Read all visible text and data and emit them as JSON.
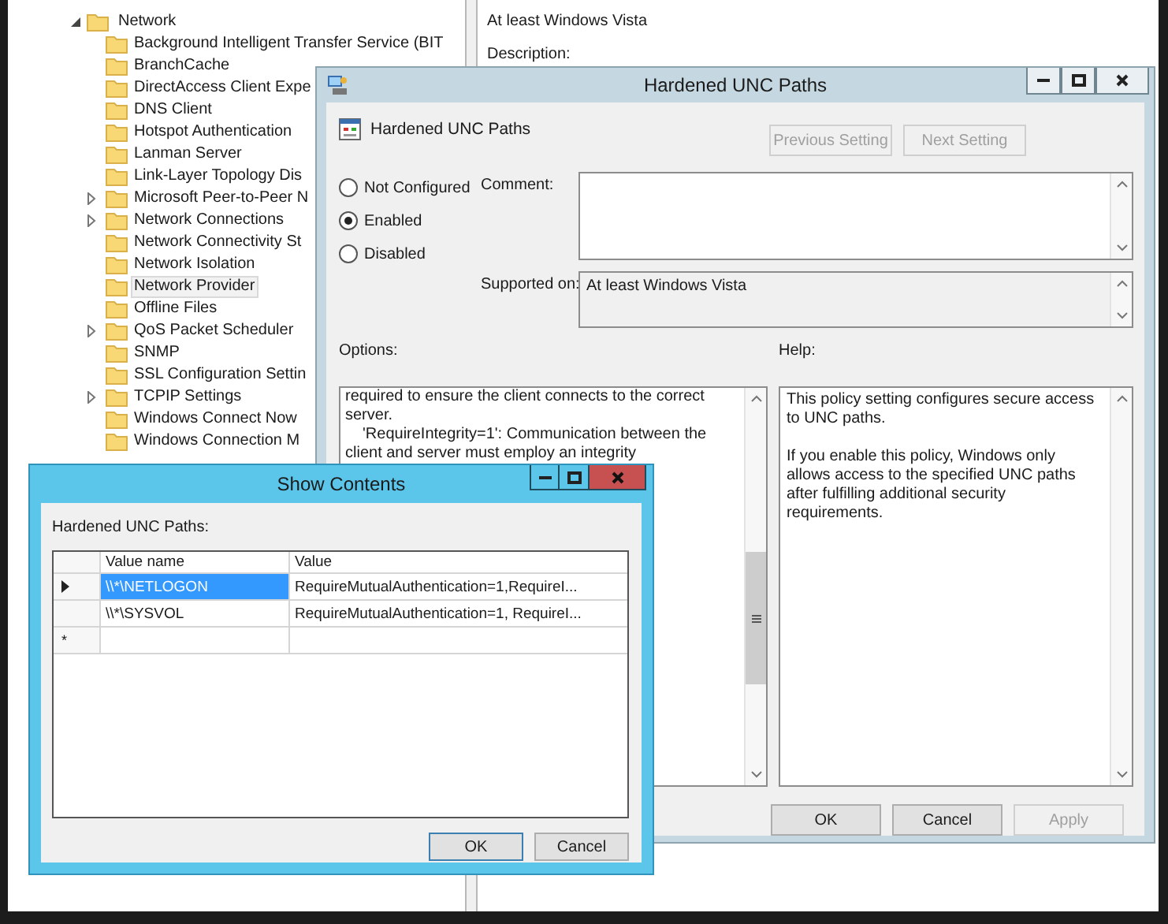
{
  "tree": {
    "label": "Network",
    "expanded": true,
    "children": [
      {
        "label": "Background Intelligent Transfer Service (BIT",
        "has_children": false,
        "selected": false
      },
      {
        "label": "BranchCache",
        "has_children": false,
        "selected": false
      },
      {
        "label": "DirectAccess Client Expe",
        "has_children": false,
        "selected": false
      },
      {
        "label": "DNS Client",
        "has_children": false,
        "selected": false
      },
      {
        "label": "Hotspot Authentication",
        "has_children": false,
        "selected": false
      },
      {
        "label": "Lanman Server",
        "has_children": false,
        "selected": false
      },
      {
        "label": "Link-Layer Topology Dis",
        "has_children": false,
        "selected": false
      },
      {
        "label": "Microsoft Peer-to-Peer N",
        "has_children": true,
        "selected": false
      },
      {
        "label": "Network Connections",
        "has_children": true,
        "selected": false
      },
      {
        "label": "Network Connectivity St",
        "has_children": false,
        "selected": false
      },
      {
        "label": "Network Isolation",
        "has_children": false,
        "selected": false
      },
      {
        "label": "Network Provider",
        "has_children": false,
        "selected": true
      },
      {
        "label": "Offline Files",
        "has_children": false,
        "selected": false
      },
      {
        "label": "QoS Packet Scheduler",
        "has_children": true,
        "selected": false
      },
      {
        "label": "SNMP",
        "has_children": false,
        "selected": false
      },
      {
        "label": "SSL Configuration Settin",
        "has_children": false,
        "selected": false
      },
      {
        "label": "TCPIP Settings",
        "has_children": true,
        "selected": false
      },
      {
        "label": "Windows Connect Now",
        "has_children": false,
        "selected": false
      },
      {
        "label": "Windows Connection M",
        "has_children": false,
        "selected": false
      }
    ]
  },
  "details": {
    "requirements_value": "At least Windows Vista",
    "description_label": "Description:"
  },
  "policy_dialog": {
    "title": "Hardened UNC Paths",
    "setting_name": "Hardened UNC Paths",
    "nav_buttons": [
      {
        "label": "Previous Setting",
        "disabled": true
      },
      {
        "label": "Next Setting",
        "disabled": true
      }
    ],
    "states": [
      {
        "label": "Not Configured",
        "selected": false
      },
      {
        "label": "Enabled",
        "selected": true
      },
      {
        "label": "Disabled",
        "selected": false
      }
    ],
    "comment_label": "Comment:",
    "supported_label": "Supported on:",
    "supported_value": "At least Windows Vista",
    "options_label": "Options:",
    "help_label": "Help:",
    "options_lines": [
      {
        "text": "required to ensure the client connects to the correct",
        "kind": "wrap"
      },
      {
        "text": "server.",
        "kind": "wrap"
      },
      {
        "text": "'RequireIntegrity=1': Communication between the",
        "kind": "item"
      },
      {
        "text": "client and server must employ an integrity",
        "kind": "wrap"
      }
    ],
    "help_paragraphs": [
      "This policy setting configures secure access to UNC paths.",
      "If you enable this policy, Windows only allows access to the specified UNC paths after fulfilling additional security requirements."
    ],
    "buttons": [
      {
        "label": "OK",
        "disabled": false
      },
      {
        "label": "Cancel",
        "disabled": false
      },
      {
        "label": "Apply",
        "disabled": true
      }
    ]
  },
  "show_contents": {
    "title": "Show Contents",
    "list_label": "Hardened UNC Paths:",
    "columns": [
      "Value name",
      "Value"
    ],
    "rows": [
      {
        "kind": "current",
        "value_name": "\\\\*\\NETLOGON",
        "value": "RequireMutualAuthentication=1,RequireI...",
        "selected": true
      },
      {
        "kind": "row",
        "value_name": "\\\\*\\SYSVOL",
        "value": "RequireMutualAuthentication=1, RequireI...",
        "selected": false
      },
      {
        "kind": "new",
        "marker": "*"
      }
    ],
    "buttons": [
      {
        "label": "OK",
        "default": true
      },
      {
        "label": "Cancel",
        "default": false
      }
    ]
  }
}
